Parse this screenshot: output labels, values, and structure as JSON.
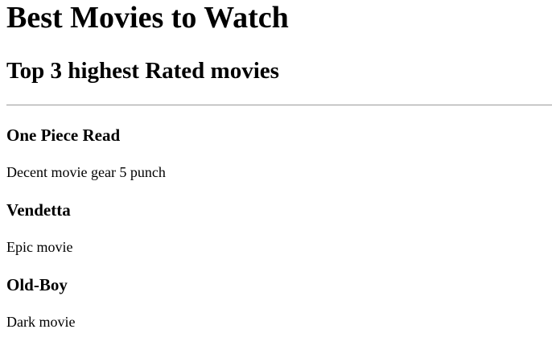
{
  "header": {
    "title": "Best Movies to Watch",
    "subtitle": "Top 3 highest Rated movies"
  },
  "movies": [
    {
      "title": "One Piece Read",
      "description": "Decent movie gear 5 punch"
    },
    {
      "title": "Vendetta",
      "description": "Epic movie"
    },
    {
      "title": "Old-Boy",
      "description": "Dark movie"
    }
  ]
}
